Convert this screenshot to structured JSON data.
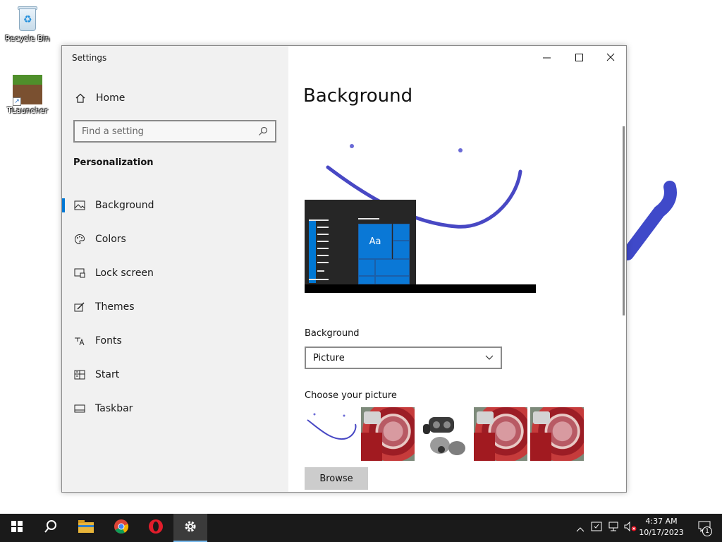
{
  "desktop": {
    "icons": [
      {
        "label": "Recycle Bin",
        "icon": "recycle-bin-icon"
      },
      {
        "label": "TLauncher",
        "icon": "minecraft-grass-block-icon"
      }
    ]
  },
  "window": {
    "title": "Settings",
    "controls": {
      "minimize": "minimize-icon",
      "maximize": "maximize-icon",
      "close": "close-icon"
    }
  },
  "sidebar": {
    "home_label": "Home",
    "search_placeholder": "Find a setting",
    "section_heading": "Personalization",
    "items": [
      {
        "label": "Background",
        "icon": "picture-icon",
        "active": true
      },
      {
        "label": "Colors",
        "icon": "palette-icon",
        "active": false
      },
      {
        "label": "Lock screen",
        "icon": "lock-screen-icon",
        "active": false
      },
      {
        "label": "Themes",
        "icon": "themes-icon",
        "active": false
      },
      {
        "label": "Fonts",
        "icon": "fonts-icon",
        "active": false
      },
      {
        "label": "Start",
        "icon": "start-icon",
        "active": false
      },
      {
        "label": "Taskbar",
        "icon": "taskbar-icon",
        "active": false
      }
    ]
  },
  "main": {
    "title": "Background",
    "preview": {
      "tile_text": "Aa"
    },
    "background_label": "Background",
    "background_value": "Picture",
    "choose_label": "Choose your picture",
    "browse_label": "Browse"
  },
  "taskbar": {
    "apps": [
      "windows-start-icon",
      "search-icon",
      "file-explorer-icon",
      "chrome-icon",
      "opera-icon",
      "settings-gear-icon"
    ],
    "active_app": "settings-gear-icon",
    "tray": [
      "chevron-up-icon",
      "security-icon",
      "network-icon",
      "volume-muted-icon"
    ],
    "time": "4:37 AM",
    "date": "10/17/2023",
    "notification_count": "1"
  },
  "colors": {
    "accent": "#0078d4",
    "sidebar_bg": "#f1f1f1",
    "taskbar_bg": "#1a1a1a",
    "stroke": "#4a4ac8"
  }
}
